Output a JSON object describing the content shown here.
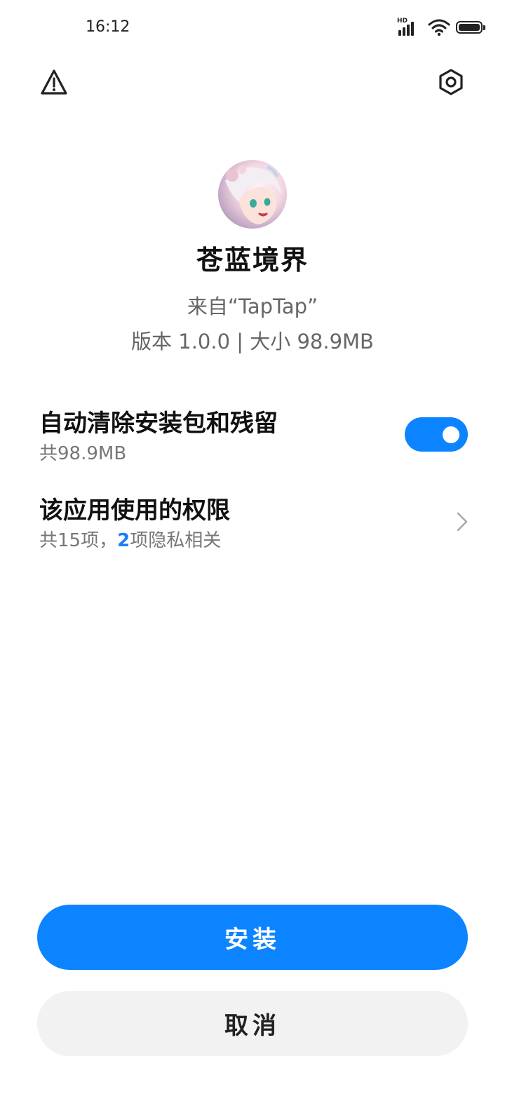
{
  "status_bar": {
    "time": "16:12",
    "network_label": "HD"
  },
  "app": {
    "name": "苍蓝境界",
    "source": "来自“TapTap”",
    "meta": "版本 1.0.0 | 大小 98.9MB"
  },
  "settings": {
    "auto_clean": {
      "title": "自动清除安装包和残留",
      "subtitle": "共98.9MB",
      "enabled": true
    },
    "permissions": {
      "title": "该应用使用的权限",
      "subtitle_prefix": "共15项，",
      "privacy_count": "2",
      "subtitle_suffix": "项隐私相关"
    }
  },
  "buttons": {
    "install": "安装",
    "cancel": "取消"
  },
  "colors": {
    "accent": "#0d84ff",
    "cancel_bg": "#f2f2f2",
    "secondary_text": "#666666"
  },
  "icons": {
    "top_left": "warning-icon",
    "top_right": "settings-icon",
    "row_arrow": "chevron-right-icon"
  }
}
